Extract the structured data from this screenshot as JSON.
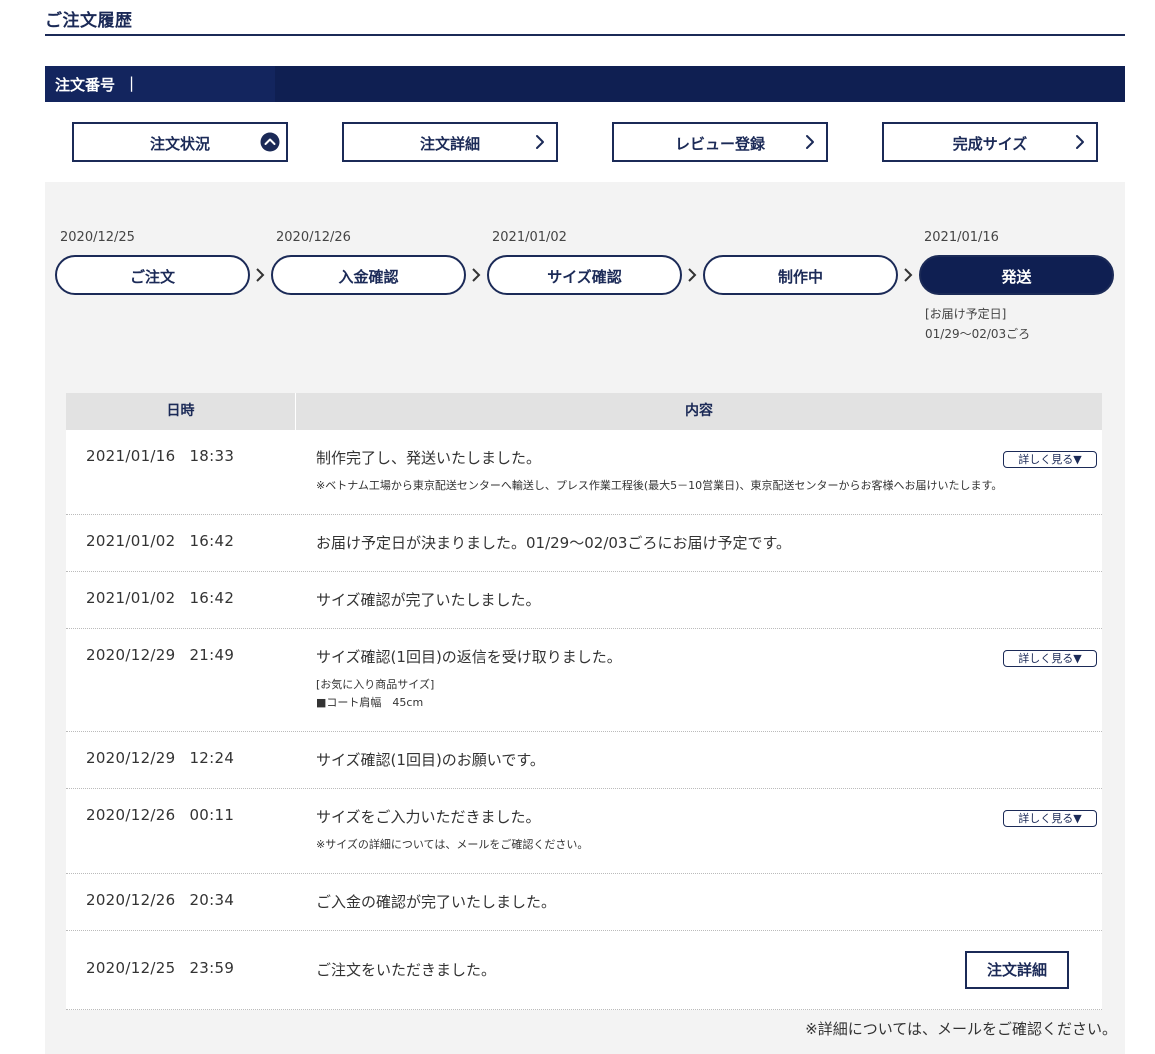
{
  "page": {
    "title": "ご注文履歴"
  },
  "order": {
    "label": "注文番号",
    "separator": "|"
  },
  "tabs": [
    {
      "label": "注文状況",
      "icon": "chevron-up-circle-icon"
    },
    {
      "label": "注文詳細",
      "icon": "chevron-right-icon"
    },
    {
      "label": "レビュー登録",
      "icon": "chevron-right-icon"
    },
    {
      "label": "完成サイズ",
      "icon": "chevron-right-icon"
    }
  ],
  "steps": [
    {
      "date": "2020/12/25",
      "label": "ご注文",
      "active": false
    },
    {
      "date": "2020/12/26",
      "label": "入金確認",
      "active": false
    },
    {
      "date": "2021/01/02",
      "label": "サイズ確認",
      "active": false
    },
    {
      "date": "",
      "label": "制作中",
      "active": false
    },
    {
      "date": "2021/01/16",
      "label": "発送",
      "active": true
    }
  ],
  "delivery": {
    "label": "[お届け予定日]",
    "range": "01/29～02/03ごろ"
  },
  "table": {
    "headers": {
      "date": "日時",
      "content": "内容"
    },
    "rows": [
      {
        "date": "2021/01/16",
        "time": "18:33",
        "text": "制作完了し、発送いたしました。",
        "notes": [
          "※ベトナム工場から東京配送センターへ輸送し、プレス作業工程後(最大5－10営業日)、東京配送センターからお客様へお届けいたします。"
        ],
        "detail": "詳しく見る▼"
      },
      {
        "date": "2021/01/02",
        "time": "16:42",
        "text": "お届け予定日が決まりました。01/29～02/03ごろにお届け予定です。",
        "notes": [],
        "detail": ""
      },
      {
        "date": "2021/01/02",
        "time": "16:42",
        "text": "サイズ確認が完了いたしました。",
        "notes": [],
        "detail": ""
      },
      {
        "date": "2020/12/29",
        "time": "21:49",
        "text": "サイズ確認(1回目)の返信を受け取りました。",
        "notes": [
          "[お気に入り商品サイズ]",
          "■コート肩幅　45cm"
        ],
        "detail": "詳しく見る▼"
      },
      {
        "date": "2020/12/29",
        "time": "12:24",
        "text": "サイズ確認(1回目)のお願いです。",
        "notes": [],
        "detail": ""
      },
      {
        "date": "2020/12/26",
        "time": "00:11",
        "text": "サイズをご入力いただきました。",
        "notes": [
          "※サイズの詳細については、メールをご確認ください。"
        ],
        "detail": "詳しく見る▼"
      },
      {
        "date": "2020/12/26",
        "time": "20:34",
        "text": "ご入金の確認が完了いたしました。",
        "notes": [],
        "detail": ""
      },
      {
        "date": "2020/12/25",
        "time": "23:59",
        "text": "ご注文をいただきました。",
        "notes": [],
        "detail": "",
        "button": "注文詳細"
      }
    ]
  },
  "footer": {
    "note": "※詳細については、メールをご確認ください。"
  },
  "colors": {
    "navy": "#1b2a57",
    "bar": "#0f1f52",
    "panel": "#f3f3f3"
  }
}
